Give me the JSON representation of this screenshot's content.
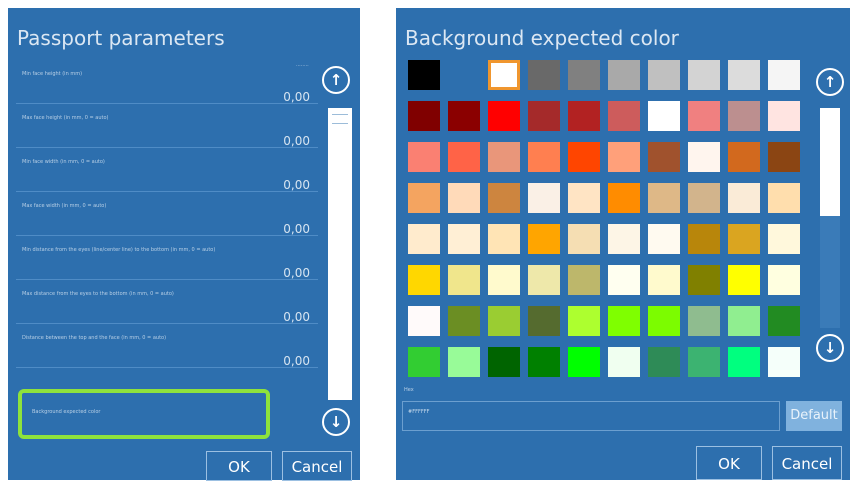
{
  "passport": {
    "title": "Passport parameters",
    "top_value": "........",
    "rows": [
      {
        "label": "Min face height (in mm)",
        "value": "0,00"
      },
      {
        "label": "Max face height (in mm, 0 = auto)",
        "value": "0,00"
      },
      {
        "label": "Min face width (in mm, 0 = auto)",
        "value": "0,00"
      },
      {
        "label": "Max face width (in mm, 0 = auto)",
        "value": "0,00"
      },
      {
        "label": "Min distance from the eyes (line/center line) to the bottom (in mm, 0 = auto)",
        "value": "0,00"
      },
      {
        "label": "Max distance from the eyes to the bottom (in mm, 0 = auto)",
        "value": "0,00"
      },
      {
        "label": "Distance between the top and the face (in mm, 0 = auto)",
        "value": "0,00"
      }
    ],
    "highlighted_row_label": "Background expected color",
    "ok_label": "OK",
    "cancel_label": "Cancel"
  },
  "color_dialog": {
    "title": "Background expected color",
    "hex_label": "Hex",
    "hex_value": "#FFFFFF",
    "default_label": "Default",
    "ok_label": "OK",
    "cancel_label": "Cancel",
    "selected_index": 2,
    "colors": [
      "#000000",
      "#2d6fae",
      "#ffffff",
      "#696969",
      "#808080",
      "#a9a9a9",
      "#c0c0c0",
      "#d3d3d3",
      "#dcdcdc",
      "#f5f5f5",
      "#800000",
      "#8b0000",
      "#ff0000",
      "#a52a2a",
      "#b22222",
      "#cd5c5c",
      "#ffffff",
      "#f08080",
      "#bc8f8f",
      "#ffe4e1",
      "#fa8072",
      "#ff6347",
      "#e9967a",
      "#ff7f50",
      "#ff4500",
      "#ffa07a",
      "#a0522d",
      "#fff5ee",
      "#d2691e",
      "#8b4513",
      "#f4a460",
      "#ffdab9",
      "#cd853f",
      "#faf0e6",
      "#ffe4c4",
      "#ff8c00",
      "#deb887",
      "#d2b48c",
      "#faebd7",
      "#ffdead",
      "#ffebcd",
      "#ffefd5",
      "#ffe4b5",
      "#ffa500",
      "#f5deb3",
      "#fdf5e6",
      "#fffaf0",
      "#b8860b",
      "#daa520",
      "#fff8dc",
      "#ffd700",
      "#f0e68c",
      "#fffacd",
      "#eee8aa",
      "#bdb76b",
      "#fffff0",
      "#fffacd",
      "#808000",
      "#ffff00",
      "#ffffe0",
      "#fffafa",
      "#6b8e23",
      "#9acd32",
      "#556b2f",
      "#adff2f",
      "#7fff00",
      "#7cfc00",
      "#8fbc8f",
      "#90ee90",
      "#228b22",
      "#32cd32",
      "#98fb98",
      "#006400",
      "#008000",
      "#00ff00",
      "#f0fff0",
      "#2e8b57",
      "#3cb371",
      "#00ff7f",
      "#f5fffa"
    ]
  }
}
